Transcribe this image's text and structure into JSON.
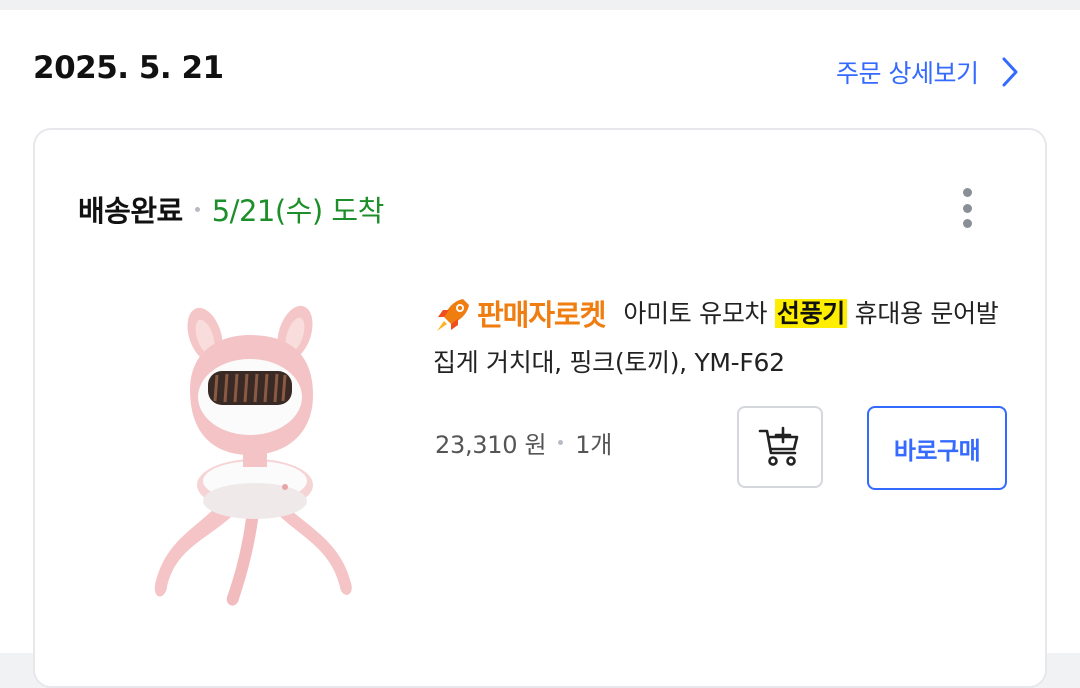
{
  "order": {
    "date": "2025. 5. 21",
    "detail_link_label": "주문 상세보기"
  },
  "shipment": {
    "status": "배송완료",
    "arrival": "5/21(수) 도착"
  },
  "product": {
    "badge": "판매자로켓",
    "title_before": "아미토 유모차 ",
    "title_highlight": "선풍기",
    "title_after": " 휴대용 문어발 집게 거치대, 핑크(토끼), YM-F62",
    "price": "23,310 원",
    "quantity": "1개",
    "image_icon": "pink-rabbit-stroller-fan-image",
    "badge_icon": "rocket-icon"
  },
  "actions": {
    "cart_icon": "add-to-cart-icon",
    "buy_now_label": "바로구매"
  },
  "colors": {
    "accent": "#346aff",
    "arrival_green": "#1d8f2a",
    "rocket_orange": "#f07d10",
    "highlight": "#ffee00"
  }
}
